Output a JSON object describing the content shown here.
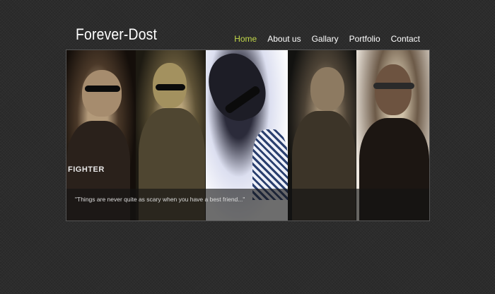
{
  "site": {
    "title": "Forever-Dost"
  },
  "nav": {
    "items": [
      {
        "label": "Home",
        "active": true
      },
      {
        "label": "About us",
        "active": false
      },
      {
        "label": "Gallary",
        "active": false
      },
      {
        "label": "Portfolio",
        "active": false
      },
      {
        "label": "Contact",
        "active": false
      }
    ]
  },
  "slider": {
    "caption": "\"Things are never quite as scary when you have a best friend...\"",
    "photo_text": "FIGHTER"
  },
  "colors": {
    "background": "#2c2c2c",
    "active_nav": "#c2d84a",
    "text": "#ffffff"
  }
}
